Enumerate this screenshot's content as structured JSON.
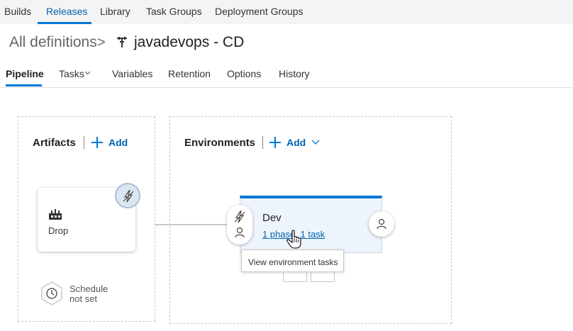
{
  "topnav": {
    "items": [
      "Builds",
      "Releases",
      "Library",
      "Task Groups",
      "Deployment Groups"
    ],
    "active_index": 1
  },
  "header": {
    "breadcrumb": "All definitions",
    "separator": ">",
    "title": "javadevops - CD",
    "title_icon": "pipeline-icon"
  },
  "tabs": {
    "items": [
      "Pipeline",
      "Tasks",
      "Variables",
      "Retention",
      "Options",
      "History"
    ],
    "active_index": 0
  },
  "artifacts": {
    "title": "Artifacts",
    "add_label": "Add",
    "items": [
      {
        "name": "Drop",
        "icon": "build-artifact-icon",
        "trigger_icon": "lightning-icon"
      }
    ],
    "schedule": {
      "line1": "Schedule",
      "line2": "not set",
      "icon": "clock-icon"
    }
  },
  "environments": {
    "title": "Environments",
    "add_label": "Add",
    "items": [
      {
        "name": "Dev",
        "link_text": "1 phase, 1 task",
        "pre_icons": [
          "lightning-icon",
          "person-icon"
        ],
        "post_icon": "person-icon"
      }
    ],
    "tooltip": "View environment tasks"
  },
  "colors": {
    "accent": "#0078d4",
    "link": "#0062b1",
    "env_card_bg": "#eef4fb",
    "trigger_bg": "#dbe6f2"
  }
}
